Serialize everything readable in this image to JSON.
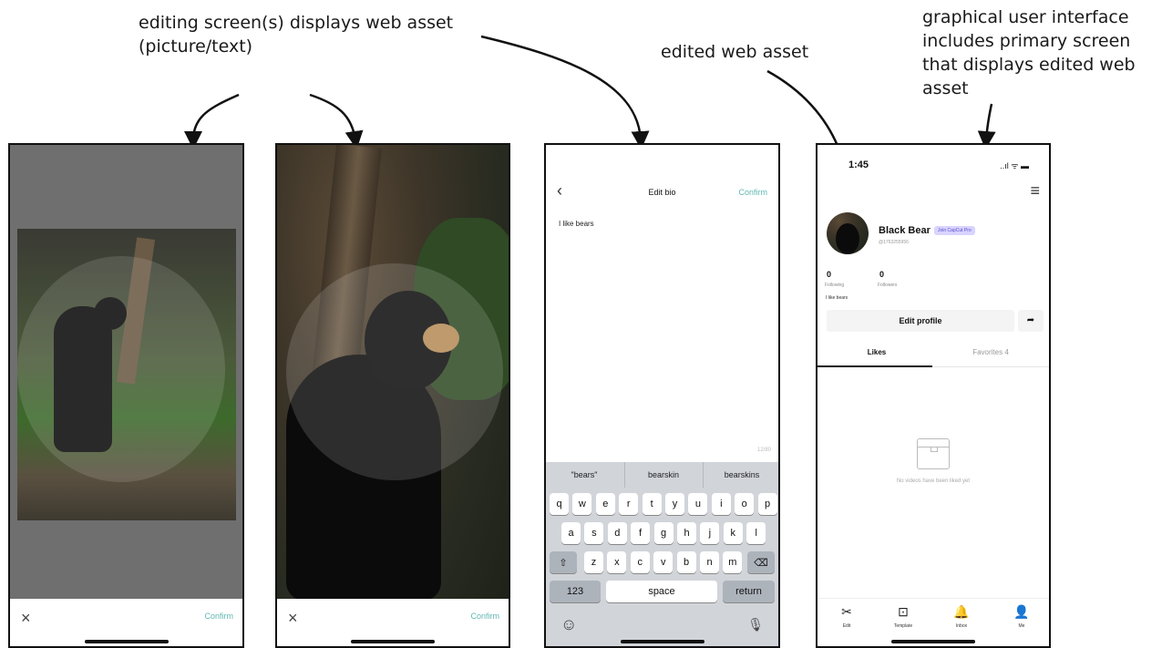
{
  "annotations": {
    "editing_line1": "editing screen(s) displays web asset",
    "editing_line2": "(picture/text)",
    "edited": "edited web asset",
    "gui_line1": "graphical user interface",
    "gui_line2": "includes primary screen",
    "gui_line3": "that displays edited web",
    "gui_line4": "asset"
  },
  "crop1": {
    "close": "×",
    "confirm": "Confirm"
  },
  "crop2": {
    "close": "×",
    "confirm": "Confirm"
  },
  "bio": {
    "back": "‹",
    "title": "Edit bio",
    "confirm": "Confirm",
    "text": "I like bears",
    "counter": "12/80",
    "suggestions": [
      "\"bears\"",
      "bearskin",
      "bearskins"
    ],
    "row1": [
      "q",
      "w",
      "e",
      "r",
      "t",
      "y",
      "u",
      "i",
      "o",
      "p"
    ],
    "row2": [
      "a",
      "s",
      "d",
      "f",
      "g",
      "h",
      "j",
      "k",
      "l"
    ],
    "row3": [
      "z",
      "x",
      "c",
      "v",
      "b",
      "n",
      "m"
    ],
    "shift": "⇧",
    "delete": "⌫",
    "num": "123",
    "space": "space",
    "return": "return",
    "emoji": "☺",
    "mic": "🎙"
  },
  "profile": {
    "time": "1:45",
    "status_icons": "..ıl ᯤ ▬",
    "menu": "≡",
    "name": "Black Bear",
    "badge": "Join CapCut Pro",
    "handle": "@1763255956",
    "following_count": "0",
    "following_label": "Following",
    "followers_count": "0",
    "followers_label": "Followers",
    "bio": "I like bears",
    "edit_profile": "Edit profile",
    "share": "➦",
    "tab_likes": "Likes",
    "tab_favorites": "Favorites 4",
    "empty_text": "No videos have been liked yet",
    "tabs": [
      {
        "icon": "✂",
        "label": "Edit"
      },
      {
        "icon": "⊡",
        "label": "Template"
      },
      {
        "icon": "🔔",
        "label": "Inbox"
      },
      {
        "icon": "👤",
        "label": "Me"
      }
    ]
  }
}
